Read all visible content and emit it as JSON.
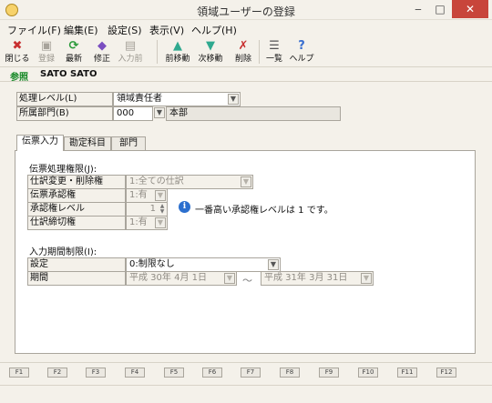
{
  "window": {
    "title": "領域ユーザーの登録",
    "minimize": "‒",
    "maximize": "□",
    "close": "✕"
  },
  "menu": [
    "ファイル(F)",
    "編集(E)",
    "設定(S)",
    "表示(V)",
    "ヘルプ(H)"
  ],
  "toolbar": {
    "close": "閉じる",
    "register": "登録",
    "refresh": "最新",
    "edit": "修正",
    "input_previous": "入力前",
    "move_prev": "前移動",
    "move_next": "次移動",
    "delete": "削除",
    "list": "一覧",
    "help": "ヘルプ"
  },
  "mode": {
    "label": "参照",
    "user": "SATO SATO"
  },
  "form": {
    "level_label": "処理レベル(L)",
    "level_value": "領域責任者",
    "dept_label": "所属部門(B)",
    "dept_code": "000",
    "dept_name": "本部"
  },
  "tabs": [
    "伝票入力",
    "勘定科目",
    "部門"
  ],
  "voucher": {
    "section_title": "伝票処理権限(J):",
    "rows": [
      {
        "label": "仕訳変更・削除権",
        "value": "1:全ての仕訳"
      },
      {
        "label": "伝票承認権",
        "value": "1:有"
      },
      {
        "label": "承認権レベル",
        "value": "1"
      },
      {
        "label": "仕訳締切権",
        "value": "1:有"
      }
    ],
    "info_icon": "i",
    "info_text": "一番高い承認権レベルは 1 です。"
  },
  "period": {
    "section_title": "入力期間制限(I):",
    "setting_label": "設定",
    "setting_value": "0:制限なし",
    "period_label": "期間",
    "from": "平成 30年 4月 1日",
    "separator": "〜",
    "to": "平成 31年 3月 31日"
  },
  "fkeys": [
    "F1",
    "F2",
    "F3",
    "F4",
    "F5",
    "F6",
    "F7",
    "F8",
    "F9",
    "F10",
    "F11",
    "F12"
  ],
  "icons": {
    "close": "close-icon",
    "register": "save-icon",
    "refresh": "refresh-icon",
    "edit": "edit-icon",
    "input_previous": "document-icon",
    "move_prev": "arrow-up-icon",
    "move_next": "arrow-down-icon",
    "delete": "delete-document-icon",
    "list": "list-icon",
    "help": "help-icon"
  },
  "colors": {
    "mode": "#1a8a2a",
    "close_button": "#c8453b",
    "info": "#2c6fce",
    "delete": "#c83030"
  }
}
